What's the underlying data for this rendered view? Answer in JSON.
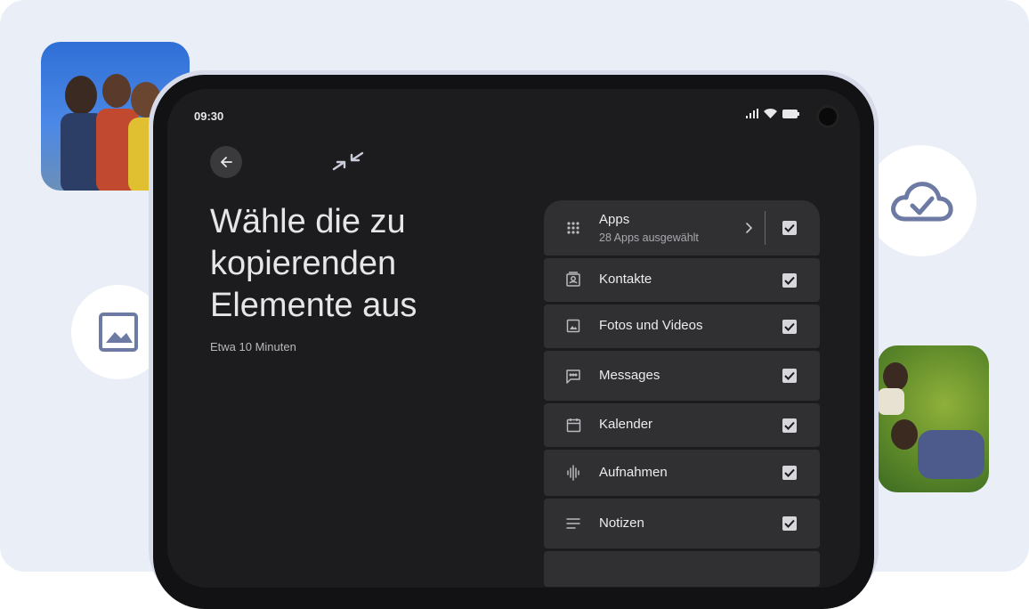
{
  "status_bar": {
    "time": "09:30"
  },
  "header": {
    "title": "Wähle die zu kopierenden Elemente aus",
    "subtitle": "Etwa 10 Minuten"
  },
  "items": [
    {
      "label": "Apps",
      "sub": "28 Apps ausgewählt",
      "checked": true,
      "icon": "apps-grid-icon"
    },
    {
      "label": "Kontakte",
      "checked": true,
      "icon": "contacts-icon"
    },
    {
      "label": "Fotos und Videos",
      "checked": true,
      "icon": "photo-icon"
    },
    {
      "label": "Messages",
      "checked": true,
      "icon": "message-icon"
    },
    {
      "label": "Kalender",
      "checked": true,
      "icon": "calendar-icon"
    },
    {
      "label": "Aufnahmen",
      "checked": true,
      "icon": "waveform-icon"
    },
    {
      "label": "Notizen",
      "checked": true,
      "icon": "notes-icon"
    }
  ],
  "colors": {
    "background": "#e9eef7",
    "screen": "#1c1c1e",
    "row": "#303033",
    "accent_icon": "#6d7aa3"
  }
}
